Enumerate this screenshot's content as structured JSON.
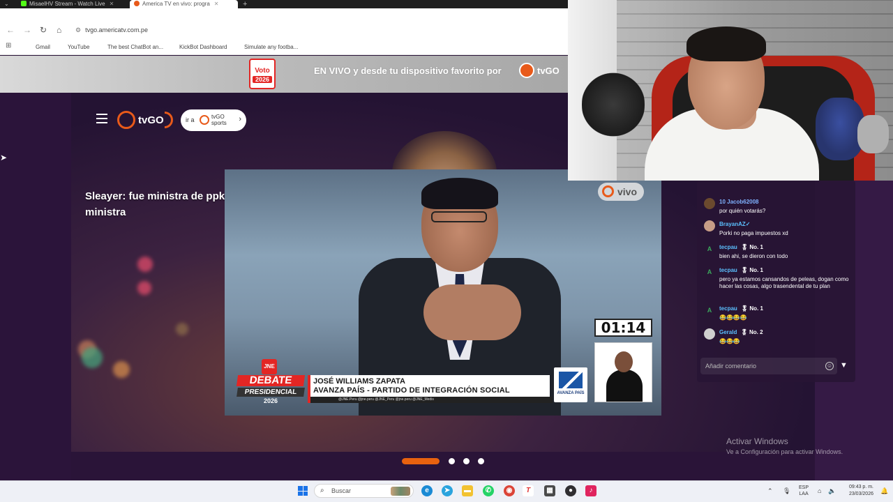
{
  "browser": {
    "tabs": [
      {
        "title": "MisaelHV Stream - Watch Live",
        "active": false
      },
      {
        "title": "America TV en vivo: progra",
        "active": true
      }
    ],
    "url": "tvgo.americatv.com.pe",
    "bookmarks": [
      {
        "label": "Gmail",
        "icon": "gmail-icon",
        "color": "#ea4335"
      },
      {
        "label": "YouTube",
        "icon": "youtube-icon",
        "color": "#ff0000"
      },
      {
        "label": "The best ChatBot an...",
        "icon": "chatbot-icon",
        "color": "#222222"
      },
      {
        "label": "KickBot Dashboard",
        "icon": "kickbot-icon",
        "color": "#f5d90a"
      },
      {
        "label": "Simulate any footba...",
        "icon": "football-icon",
        "color": "#6a2bbf"
      }
    ]
  },
  "banner": {
    "voto_line1": "Voto",
    "voto_line2": "2026",
    "text": "EN VIVO y desde tu dispositivo favorito por",
    "brand": "tvGO"
  },
  "header": {
    "logo_text": "tvGO",
    "sports_prefix": "ir a",
    "sports_brand_top": "tvGO",
    "sports_brand_bottom": "sports"
  },
  "overlay_chat": {
    "user": "Sleayer:",
    "message": " fue ministra de ppk y protegio a odebretch siendo ministra"
  },
  "video": {
    "live_badge": "vivo",
    "timer": "01:14",
    "debate_jne": "JNE",
    "debate_title": "DEBATE",
    "debate_subtitle": "PRESIDENCIAL",
    "debate_year": "2026",
    "candidate_name": "JOSÉ WILLIAMS ZAPATA",
    "candidate_party": "AVANZA PAÍS - PARTIDO DE INTEGRACIÓN SOCIAL",
    "social_handles": "@JNE.Peru     @jne.peru     @JNE_Peru     @jne.peru     @JNE_Medis",
    "party_logo_label": "AVANZA PAÍS"
  },
  "chat": {
    "messages": [
      {
        "user": "Jacob62008",
        "badge": "10",
        "text": "por quién votarás?",
        "user_color": "#7fb2ff",
        "avatar_color": "#6b4a2e",
        "avatar_letter": ""
      },
      {
        "user": "BrayanAZ✓",
        "badge": "",
        "text": "Porki no paga impuestos xd",
        "user_color": "#5bc0ff",
        "avatar_color": "#c79d86",
        "avatar_letter": ""
      },
      {
        "user": "tecpau",
        "badge": "No. 1",
        "text": "bien ahi, se dieron con todo",
        "user_color": "#5bc0ff",
        "avatar_color": "#3ba55c",
        "avatar_letter": "A"
      },
      {
        "user": "tecpau",
        "badge": "No. 1",
        "text": "pero ya estamos cansandos de peleas, dogan como hacer las cosas, algo trasendental de tu plan",
        "user_color": "#5bc0ff",
        "avatar_color": "#3ba55c",
        "avatar_letter": "A"
      },
      {
        "user": "tecpau",
        "badge": "No. 1",
        "text": "😂😂😂😂",
        "user_color": "#5bc0ff",
        "avatar_color": "#3ba55c",
        "avatar_letter": "A"
      },
      {
        "user": "Gerald",
        "badge": "No. 2",
        "text": "😂😂😂",
        "user_color": "#5bc0ff",
        "avatar_color": "#cfcfcf",
        "avatar_letter": ""
      }
    ],
    "input_placeholder": "Añadir comentario"
  },
  "windows": {
    "activate_title": "Activar Windows",
    "activate_sub": "Ve a Configuración para activar Windows."
  },
  "pager": {
    "count": 4,
    "active": 0
  },
  "taskbar": {
    "search_placeholder": "Buscar",
    "lang_line1": "ESP",
    "lang_line2": "LAA",
    "time": "09:43 p. m.",
    "date": "23/03/2026",
    "apps": [
      {
        "name": "edge-icon",
        "color": "#1a8ad4",
        "glyph": "e"
      },
      {
        "name": "telegram-icon",
        "color": "#2aa3dd",
        "glyph": "➤"
      },
      {
        "name": "file-explorer-icon",
        "color": "#f2c231",
        "glyph": "▬"
      },
      {
        "name": "whatsapp-icon",
        "color": "#25d366",
        "glyph": "✆"
      },
      {
        "name": "chrome-icon",
        "color": "#db4437",
        "glyph": "◉"
      },
      {
        "name": "typora-icon",
        "color": "#ffffff",
        "glyph": "T"
      },
      {
        "name": "calculator-icon",
        "color": "#4a4a4a",
        "glyph": "▦"
      },
      {
        "name": "obs-icon",
        "color": "#302e31",
        "glyph": "●"
      },
      {
        "name": "tiktok-icon",
        "color": "#e0245e",
        "glyph": "♪"
      }
    ]
  }
}
